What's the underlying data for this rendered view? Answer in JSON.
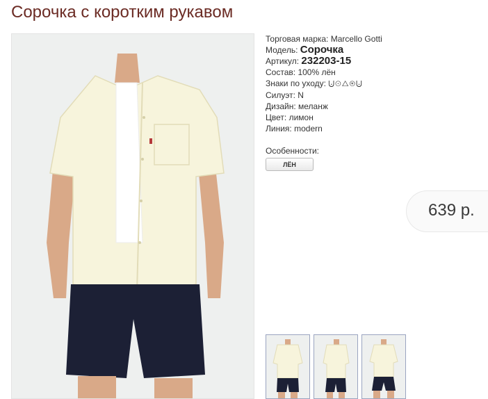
{
  "page": {
    "title": "Сорочка с коротким рукавом"
  },
  "details": {
    "brand_label": "Торговая марка:",
    "brand_value": "Marcello Gotti",
    "model_label": "Модель:",
    "model_value": "Сорочка",
    "sku_label": "Артикул:",
    "sku_value": "232203-15",
    "composition_label": "Состав:",
    "composition_value": "100% лён",
    "care_label": "Знаки по уходу:",
    "care_symbols": "⨃⊙△⊛⨃",
    "silhouette_label": "Силуэт:",
    "silhouette_value": "N",
    "design_label": "Дизайн:",
    "design_value": "меланж",
    "color_label": "Цвет:",
    "color_value": "лимон",
    "line_label": "Линия:",
    "line_value": "modern"
  },
  "features": {
    "label": "Особенности:",
    "tag": "ЛЁН"
  },
  "price": {
    "value": "639 р."
  },
  "colors": {
    "title": "#6b2b24",
    "shirt": "#f7f4dc",
    "shorts": "#1c2035",
    "skin": "#d9a988"
  }
}
